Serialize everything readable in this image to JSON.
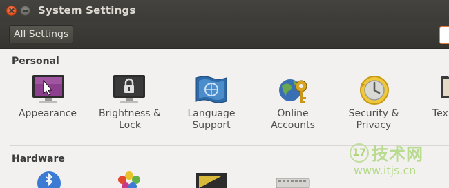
{
  "window": {
    "title": "System Settings"
  },
  "toolbar": {
    "all_settings_label": "All Settings"
  },
  "sections": {
    "personal": {
      "title": "Personal",
      "items": [
        {
          "label": "Appearance",
          "label2": "",
          "icon": "appearance-icon"
        },
        {
          "label": "Brightness &",
          "label2": "Lock",
          "icon": "brightness-lock-icon"
        },
        {
          "label": "Language",
          "label2": "Support",
          "icon": "language-support-icon"
        },
        {
          "label": "Online",
          "label2": "Accounts",
          "icon": "online-accounts-icon"
        },
        {
          "label": "Security &",
          "label2": "Privacy",
          "icon": "security-privacy-icon"
        },
        {
          "label": "Tex",
          "label2": "",
          "icon": "text-entry-icon"
        }
      ]
    },
    "hardware": {
      "title": "Hardware"
    }
  },
  "watermark": {
    "logo": "17",
    "title": "技术网",
    "url": "www.itjs.cn"
  },
  "colors": {
    "titlebar": "#3c3b37",
    "close_button": "#e2531f",
    "accent": "#e77a3b",
    "content_bg": "#f2f1f0"
  }
}
